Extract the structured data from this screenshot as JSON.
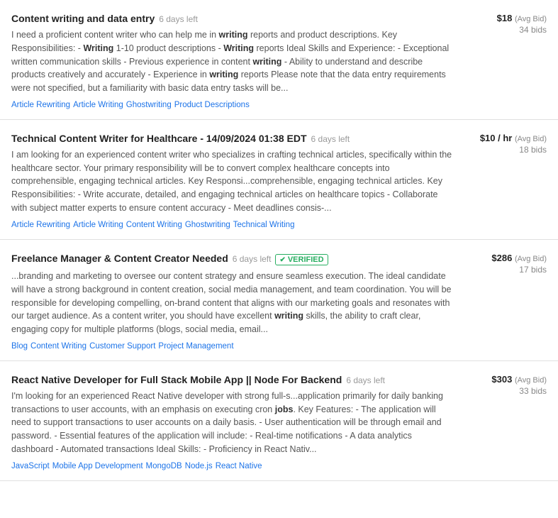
{
  "jobs": [
    {
      "id": "job-1",
      "title": "Content writing and data entry",
      "time_left": "6 days left",
      "verified": false,
      "description": "I need a proficient content writer who can help me in <strong>writing</strong> reports and product descriptions. Key Responsibilities: - <strong>Writing</strong> 1-10 product descriptions - <strong>Writing</strong> reports Ideal Skills and Experience: - Exceptional written communication skills - Previous experience in content <strong>writing</strong> - Ability to understand and describe products creatively and accurately - Experience in <strong>writing</strong> reports Please note that the data entry requirements were not specified, but a familiarity with basic data entry tasks will be...",
      "tags": [
        "Article Rewriting",
        "Article Writing",
        "Ghostwriting",
        "Product Descriptions"
      ],
      "price": "$18",
      "price_label": "(Avg Bid)",
      "bids": "34 bids"
    },
    {
      "id": "job-2",
      "title": "Technical Content Writer for Healthcare - 14/09/2024 01:38 EDT",
      "time_left": "6 days left",
      "verified": false,
      "description": "I am looking for an experienced content writer who specializes in crafting technical articles, specifically within the healthcare sector. Your primary responsibility will be to convert complex healthcare concepts into comprehensible, engaging technical articles. Key Responsi...comprehensible, engaging technical articles. Key Responsibilities: - Write accurate, detailed, and engaging technical articles on healthcare topics - Collaborate with subject matter experts to ensure content accuracy - Meet deadlines consis-...",
      "tags": [
        "Article Rewriting",
        "Article Writing",
        "Content Writing",
        "Ghostwriting",
        "Technical Writing"
      ],
      "price": "$10 / hr",
      "price_label": "(Avg Bid)",
      "bids": "18 bids"
    },
    {
      "id": "job-3",
      "title": "Freelance Manager & Content Creator Needed",
      "time_left": "6 days left",
      "verified": true,
      "description": "...branding and marketing to oversee our content strategy and ensure seamless execution. The ideal candidate will have a strong background in content creation, social media management, and team coordination. You will be responsible for developing compelling, on-brand content that aligns with our marketing goals and resonates with our target audience. As a content writer, you should have excellent <strong>writing</strong> skills, the ability to craft clear, engaging copy for multiple platforms (blogs, social media, email...",
      "tags": [
        "Blog",
        "Content Writing",
        "Customer Support",
        "Project Management"
      ],
      "price": "$286",
      "price_label": "(Avg Bid)",
      "bids": "17 bids"
    },
    {
      "id": "job-4",
      "title": "React Native Developer for Full Stack Mobile App || Node For Backend",
      "time_left": "6 days left",
      "verified": false,
      "description": "I'm looking for an experienced React Native developer with strong full-s...application primarily for daily banking transactions to user accounts, with an emphasis on executing cron <strong>jobs</strong>. Key Features: - The application will need to support transactions to user accounts on a daily basis. - User authentication will be through email and password. - Essential features of the application will include: - Real-time notifications - A data analytics dashboard - Automated transactions Ideal Skills: - Proficiency in React Nativ...",
      "tags": [
        "JavaScript",
        "Mobile App Development",
        "MongoDB",
        "Node.js",
        "React Native"
      ],
      "price": "$303",
      "price_label": "(Avg Bid)",
      "bids": "33 bids"
    }
  ],
  "verified_label": "VERIFIED"
}
